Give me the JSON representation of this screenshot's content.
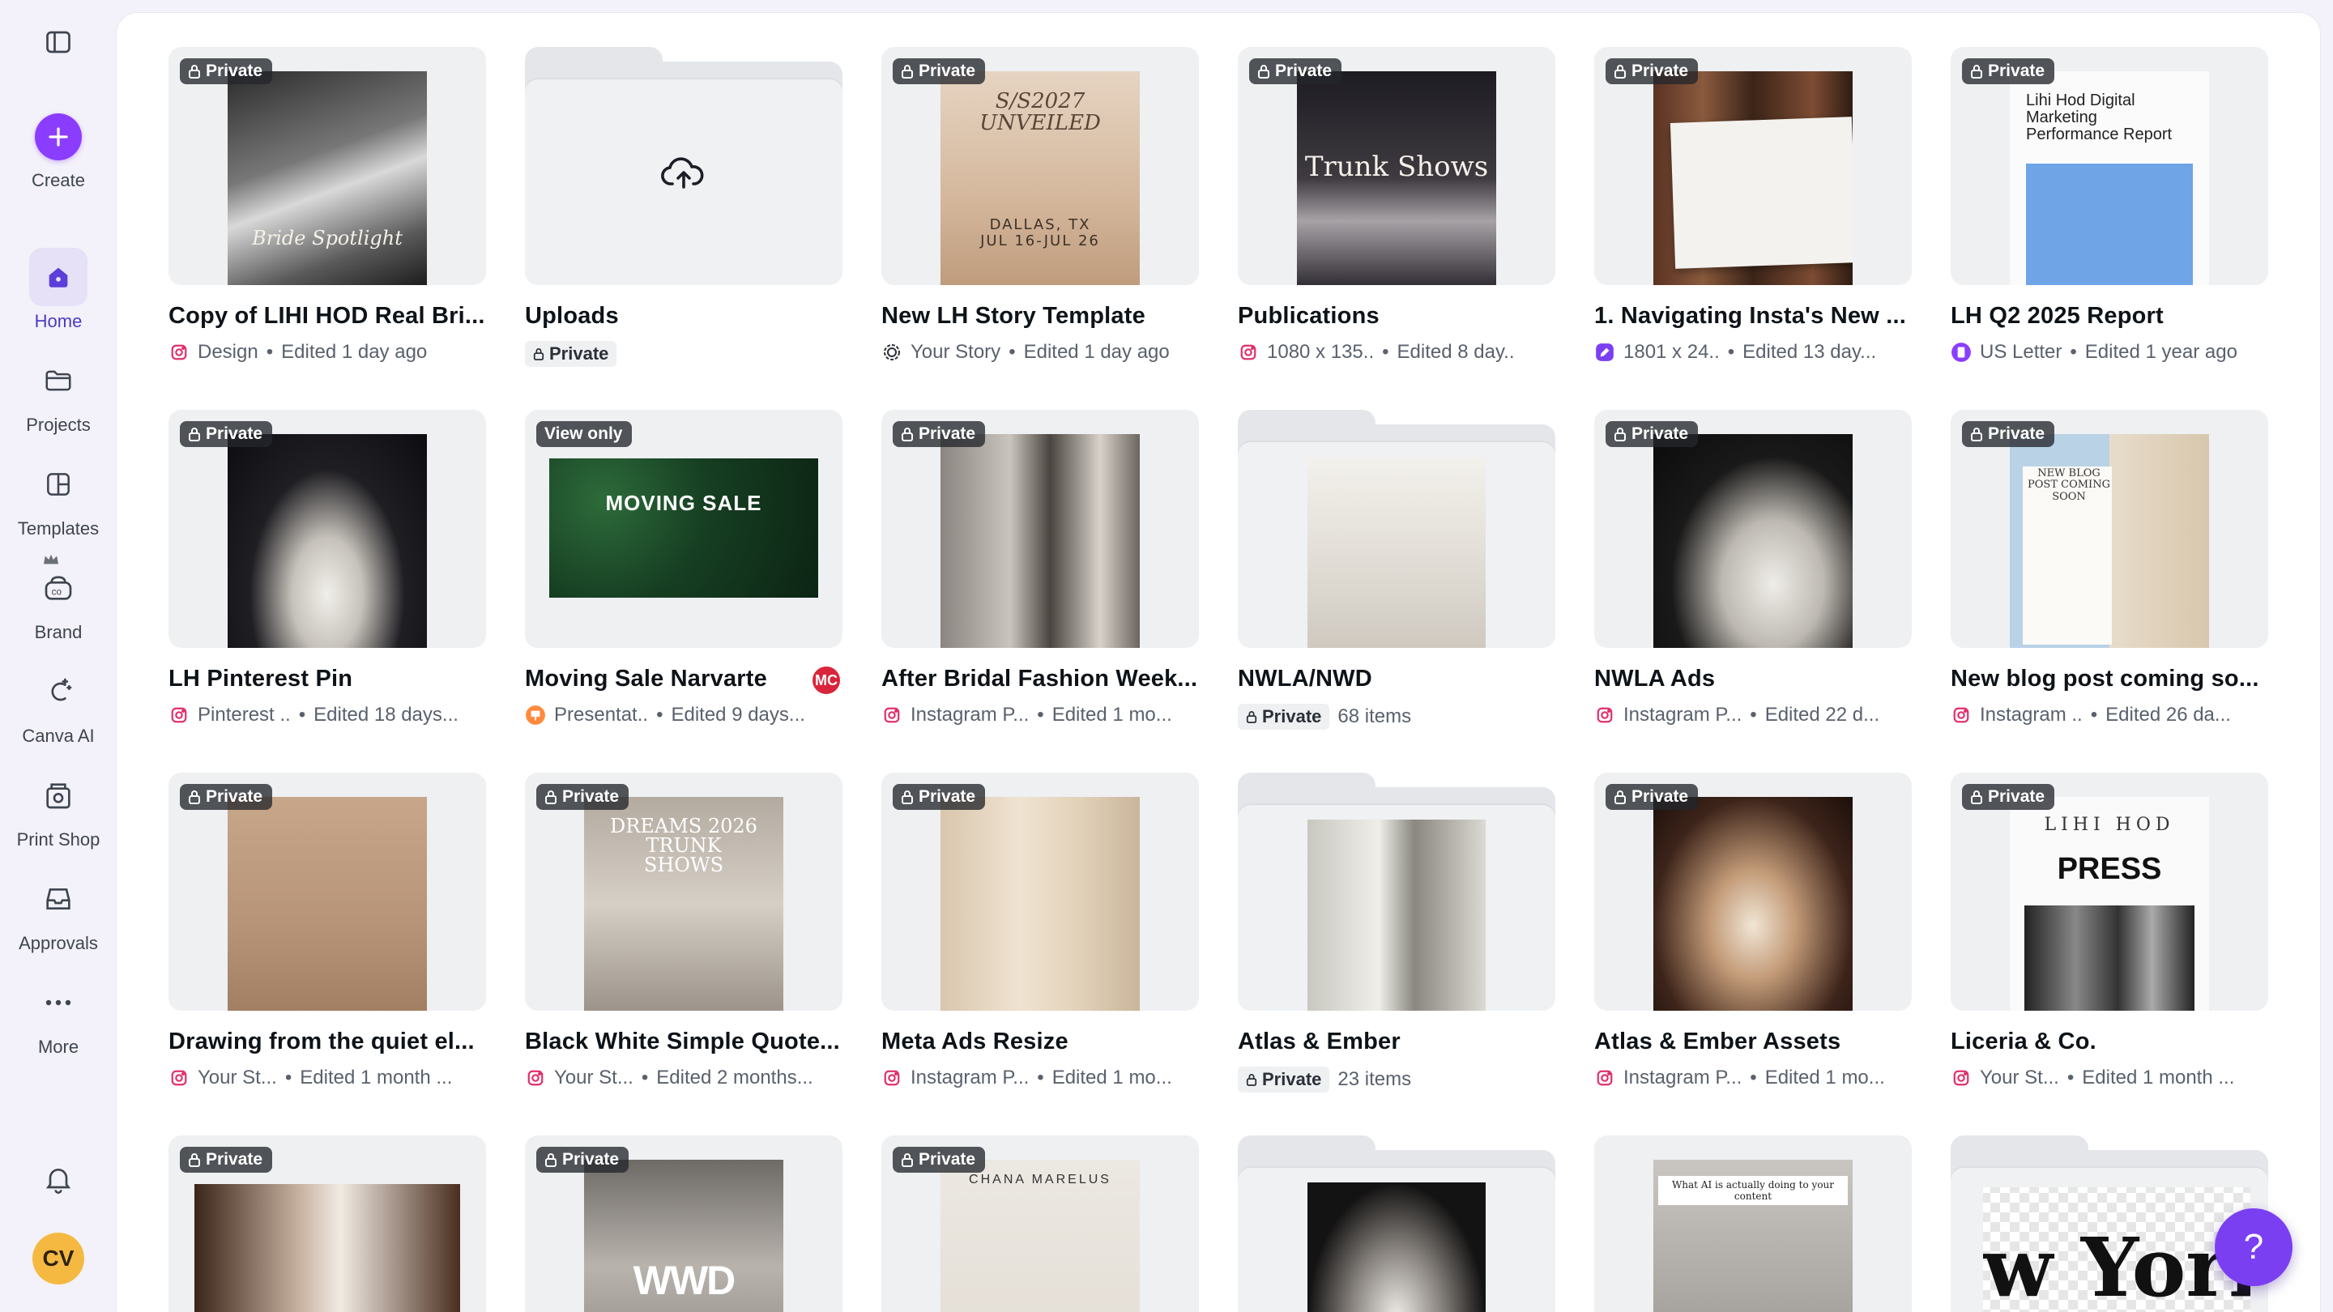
{
  "sidebar": {
    "create_label": "Create",
    "items": [
      {
        "label": "Home",
        "icon": "home-icon"
      },
      {
        "label": "Projects",
        "icon": "folder-icon"
      },
      {
        "label": "Templates",
        "icon": "templates-icon"
      },
      {
        "label": "Brand",
        "icon": "brand-icon"
      },
      {
        "label": "Canva AI",
        "icon": "canva-ai-icon"
      },
      {
        "label": "Print Shop",
        "icon": "print-shop-icon"
      },
      {
        "label": "Approvals",
        "icon": "approvals-icon"
      },
      {
        "label": "More",
        "icon": "more-icon"
      }
    ],
    "avatar_initials": "CV"
  },
  "help_label": "?",
  "colors": {
    "accent": "#8b3dff",
    "active_bg": "#e6e1f7",
    "instagram": "#e1306c",
    "fab": "#7b3ff2"
  },
  "rows": [
    [
      {
        "title": "Copy of LIHI HOD Real Bri...",
        "badge": "Private",
        "meta_icon": "instagram-icon",
        "type": "Design",
        "edited": "Edited 1 day ago",
        "thumb_text": "Bride Spotlight"
      },
      {
        "title": "Uploads",
        "folder": true,
        "chip": "Private",
        "folder_icon": "cloud-upload-icon"
      },
      {
        "title": "New LH Story Template",
        "badge": "Private",
        "meta_icon": "story-icon",
        "type": "Your Story",
        "edited": "Edited 1 day ago",
        "thumb_text": "S/S2027 UNVEILED",
        "thumb_sub": "DALLAS, TX JUL 16-JUL 26"
      },
      {
        "title": "Publications",
        "badge": "Private",
        "meta_icon": "instagram-icon",
        "type": "1080 x 135..",
        "edited": "Edited 8 day..",
        "thumb_text": "Trunk Shows"
      },
      {
        "title": "1. Navigating Insta's New ...",
        "badge": "Private",
        "meta_icon": "pen-icon",
        "type": "1801 x 24..",
        "edited": "Edited 13 day..."
      },
      {
        "title": "LH Q2 2025 Report",
        "badge": "Private",
        "meta_icon": "doc-icon",
        "type": "US Letter",
        "edited": "Edited 1 year ago",
        "thumb_text": "Lihi Hod Digital Marketing Performance Report"
      }
    ],
    [
      {
        "title": "LH Pinterest Pin",
        "badge": "Private",
        "meta_icon": "instagram-icon",
        "type": "Pinterest ..",
        "edited": "Edited 18 days..."
      },
      {
        "title": "Moving Sale Narvarte",
        "badge": "View only",
        "meta_icon": "presentation-icon",
        "type": "Presentat..",
        "edited": "Edited 9 days...",
        "thumb_text": "MOVING SALE",
        "owner_badge": "MC"
      },
      {
        "title": "After Bridal Fashion Week...",
        "badge": "Private",
        "meta_icon": "instagram-icon",
        "type": "Instagram P...",
        "edited": "Edited 1 mo..."
      },
      {
        "title": "NWLA/NWD",
        "folder": true,
        "chip": "Private",
        "count": "68 items"
      },
      {
        "title": "NWLA Ads",
        "badge": "Private",
        "meta_icon": "instagram-icon",
        "type": "Instagram P...",
        "edited": "Edited 22 d..."
      },
      {
        "title": "New blog post coming so...",
        "badge": "Private",
        "meta_icon": "instagram-icon",
        "type": "Instagram ..",
        "edited": "Edited 26 da...",
        "thumb_text": "NEW BLOG POST COMING SOON"
      }
    ],
    [
      {
        "title": "Drawing from the quiet el...",
        "badge": "Private",
        "meta_icon": "instagram-icon",
        "type": "Your St...",
        "edited": "Edited 1 month ..."
      },
      {
        "title": "Black White Simple Quote...",
        "badge": "Private",
        "meta_icon": "instagram-icon",
        "type": "Your St...",
        "edited": "Edited 2 months...",
        "thumb_text": "DREAMS 2026 TRUNK SHOWS"
      },
      {
        "title": "Meta Ads Resize",
        "badge": "Private",
        "meta_icon": "instagram-icon",
        "type": "Instagram P...",
        "edited": "Edited 1 mo..."
      },
      {
        "title": "Atlas & Ember",
        "folder": true,
        "chip": "Private",
        "count": "23 items"
      },
      {
        "title": "Atlas & Ember Assets",
        "badge": "Private",
        "meta_icon": "instagram-icon",
        "type": "Instagram P...",
        "edited": "Edited 1 mo..."
      },
      {
        "title": "Liceria & Co.",
        "badge": "Private",
        "meta_icon": "instagram-icon",
        "type": "Your St...",
        "edited": "Edited 1 month ...",
        "thumb_text": "LIHI HOD",
        "thumb_sub": "PRESS"
      }
    ],
    [
      {
        "badge": "Private"
      },
      {
        "badge": "Private",
        "thumb_text": "WWD"
      },
      {
        "badge": "Private",
        "thumb_text": "CHANA MARELUS"
      },
      {
        "folder": true
      },
      {
        "thumb_text": "What AI is actually doing to your content"
      },
      {
        "folder": true,
        "thumb_text": "w York"
      }
    ]
  ]
}
